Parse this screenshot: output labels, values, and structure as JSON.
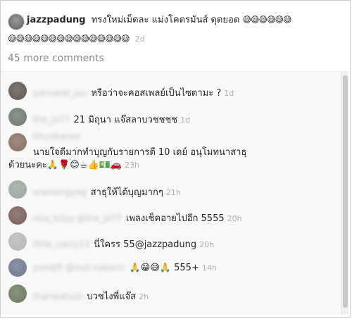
{
  "post": {
    "username": "jazzpadung",
    "text": "ทรงใหม่เม็ดละ แม่งโคตรมันส์ ดุดยอด",
    "emojis_line1": "😅😅😅😅😅😅",
    "emojis_line2": "😅😅😅😅😅😅😅😅😅😅😅😅😅😅😅",
    "age": "2d"
  },
  "more_comments": "45 more comments",
  "comments": [
    {
      "name": "panuwat_jau",
      "text": "หรือว่าจะคอสเพลย์เป็นไซตามะ ?",
      "age": "1d",
      "avatar_color": "#5f5752"
    },
    {
      "name": "the_jo77",
      "text": "21 มิถุนา แจ๊สลาบวชชชช",
      "age": "1d",
      "avatar_color": "#6f7a70"
    },
    {
      "name": "khunbanee",
      "text": "นายใจดีมากทำบุญกับรายการตี 10 เดย์ อนุโมทนาสาธุ",
      "text2": "ด้วยนะคะ🙏🌹😊☕👍💵🚗",
      "age": "23h",
      "avatar_color": "#8b6f63"
    },
    {
      "name": "vramongyag",
      "text": "สาธุให้ได้บุญมากๆ",
      "age": "21h",
      "avatar_color": "#9da6a0"
    },
    {
      "name": "nita_b5yy @the_jo77",
      "text": "เพลงเช็คอายไปอีก 5555",
      "age": "20h",
      "avatar_color": "#7a5e5a"
    },
    {
      "name": "little_catzy13",
      "text": "นี่ใครร 55@jazzpadung",
      "age": "20h",
      "avatar_color": "#b8b8b8"
    },
    {
      "name": "pondjft @mot.nakarin",
      "text": "🙏😁😅🙏 555+",
      "age": "14h",
      "avatar_color": "#6f7892"
    },
    {
      "name": "thanwatsob",
      "text": "บวชไงพี่แจ๊ส",
      "age": "2h",
      "avatar_color": "#6e7a5e"
    }
  ]
}
